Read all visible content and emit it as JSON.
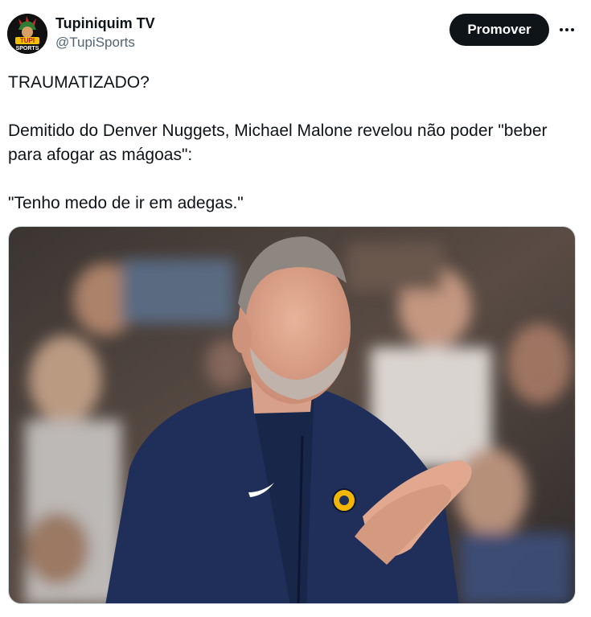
{
  "account": {
    "display_name": "Tupiniquim TV",
    "handle": "@TupiSports",
    "avatar_text": [
      "TUPI",
      "SPORTS"
    ]
  },
  "actions": {
    "promote_label": "Promover",
    "more_icon": "more-horizontal-icon"
  },
  "tweet": {
    "line1": "TRAUMATIZADO?",
    "line2": "Demitido do Denver Nuggets, Michael Malone revelou não poder \"beber para afogar as mágoas\":",
    "line3": "\"Tenho medo de ir em adegas.\""
  },
  "colors": {
    "text": "#0f1419",
    "secondary": "#536471",
    "button_bg": "#0f1419",
    "jacket": "#1f2f5a"
  }
}
